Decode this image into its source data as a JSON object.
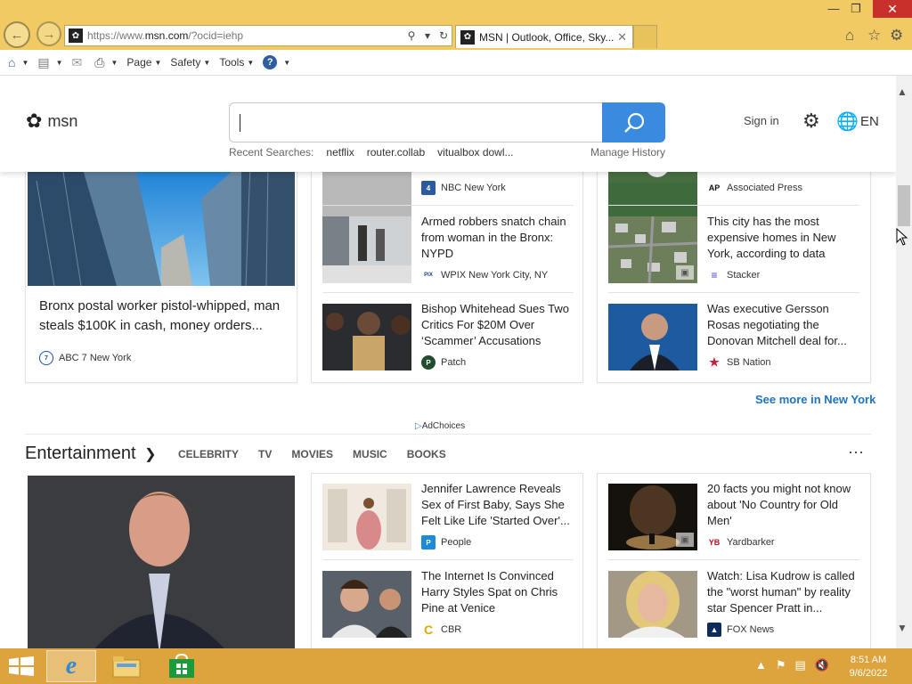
{
  "browser": {
    "url_prefix": "https://www.",
    "url_domain": "msn.com",
    "url_suffix": "/?ocid=iehp",
    "tab_title": "MSN | Outlook, Office, Sky...",
    "commands": {
      "page": "Page",
      "safety": "Safety",
      "tools": "Tools"
    }
  },
  "header": {
    "logo_text": "msn",
    "recent_label": "Recent Searches:",
    "recent": [
      "netflix",
      "router.collab",
      "vitualbox dowl..."
    ],
    "manage_history": "Manage History",
    "sign_in": "Sign in",
    "lang": "EN"
  },
  "news": {
    "main_title": "Bronx postal worker pistol-whipped, man steals $100K in cash, money orders...",
    "main_source": "ABC 7 New York",
    "col1": [
      {
        "title": "",
        "source": "NBC New York"
      },
      {
        "title": "Armed robbers snatch chain from woman in the Bronx: NYPD",
        "source": "WPIX New York City, NY"
      },
      {
        "title": "Bishop Whitehead Sues Two Critics For $20M Over ‘Scammer’ Accusations",
        "source": "Patch"
      }
    ],
    "col2": [
      {
        "title": "",
        "source": "Associated Press"
      },
      {
        "title": "This city has the most expensive homes in New York, according to data",
        "source": "Stacker"
      },
      {
        "title": "Was executive Gersson Rosas negotiating the Donovan Mitchell deal for...",
        "source": "SB Nation"
      }
    ],
    "see_more": "See more in New York",
    "adchoices": "AdChoices"
  },
  "entertainment": {
    "heading": "Entertainment",
    "tabs": [
      "CELEBRITY",
      "TV",
      "MOVIES",
      "MUSIC",
      "BOOKS"
    ],
    "col1": [
      {
        "title": "Jennifer Lawrence Reveals Sex of First Baby, Says She Felt Like Life 'Started Over'...",
        "source": "People"
      },
      {
        "title": "The Internet Is Convinced Harry Styles Spat on Chris Pine at Venice",
        "source": "CBR"
      }
    ],
    "col2": [
      {
        "title": "20 facts you might not know about 'No Country for Old Men'",
        "source": "Yardbarker"
      },
      {
        "title": "Watch: Lisa Kudrow is called the \"worst human\" by reality star Spencer Pratt in...",
        "source": "FOX News"
      }
    ]
  },
  "taskbar": {
    "time": "8:51 AM",
    "date": "9/6/2022"
  }
}
